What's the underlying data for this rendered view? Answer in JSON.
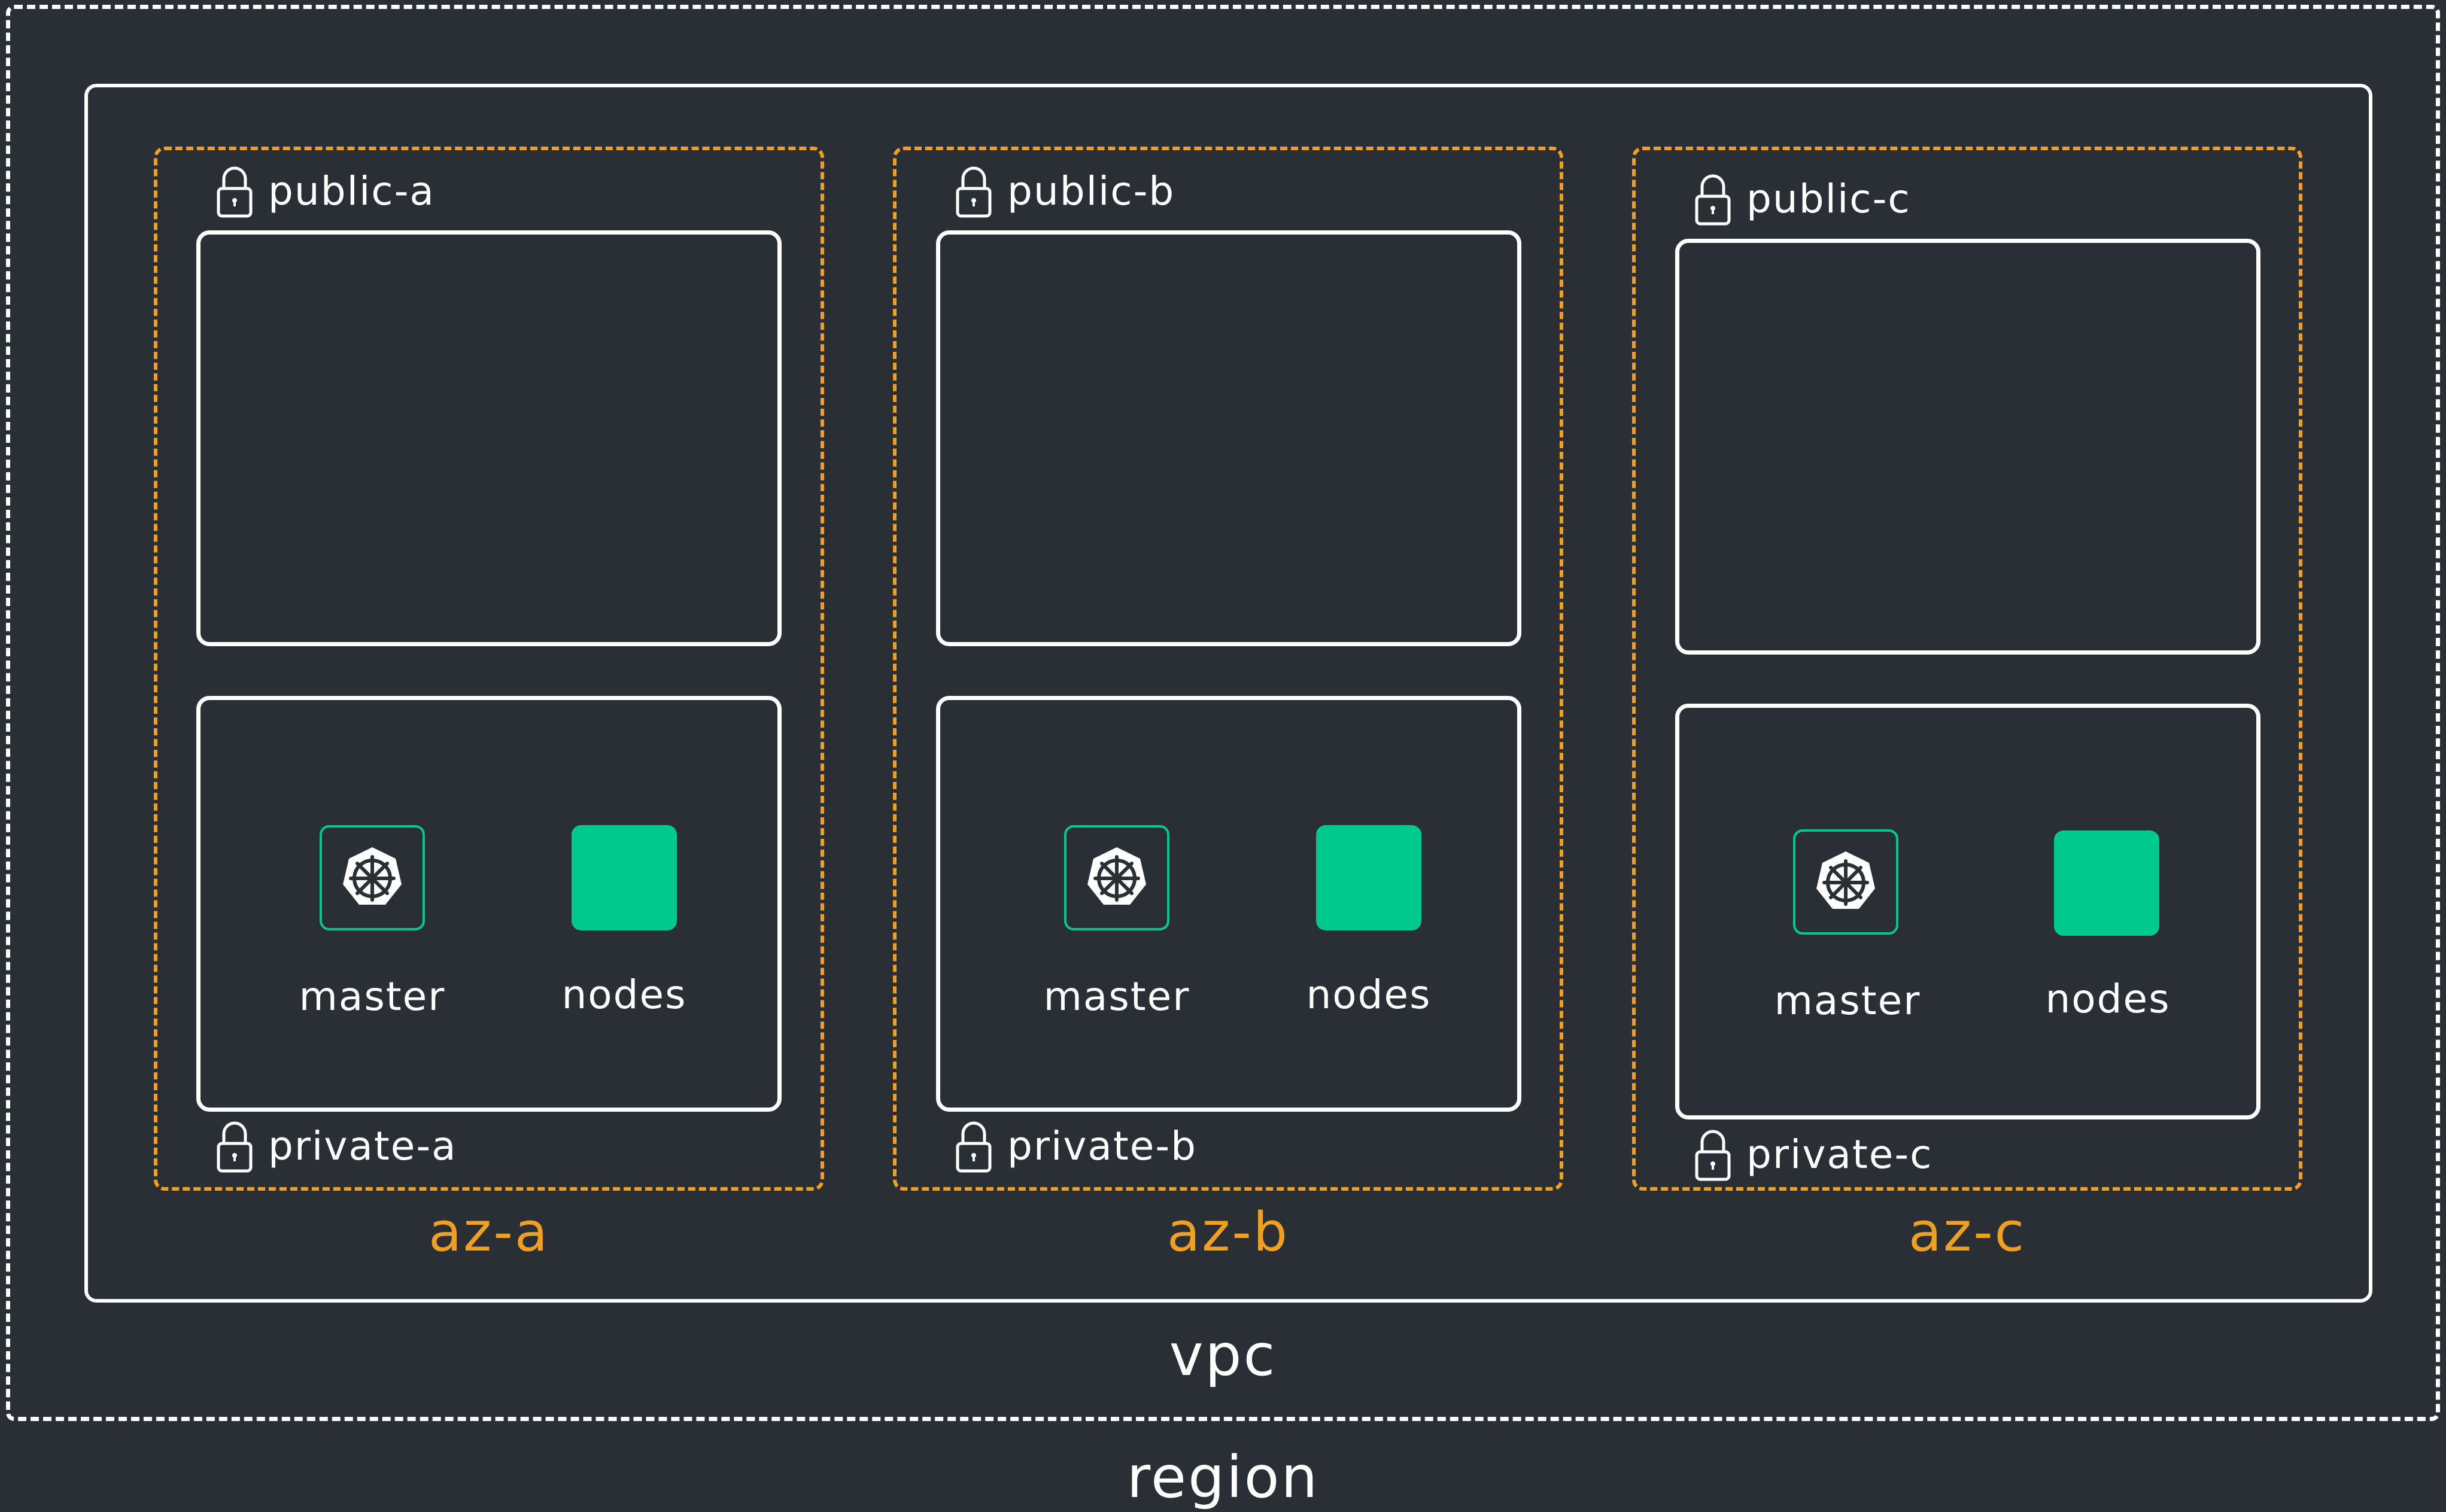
{
  "region_label": "region",
  "vpc_label": "vpc",
  "colors": {
    "background": "#2a2e35",
    "line": "#ffffff",
    "az_border": "#f0a020",
    "accent_green": "#00c98d"
  },
  "zones": [
    {
      "label": "az-a",
      "public_subnet": "public-a",
      "private_subnet": "private-a",
      "master_label": "master",
      "nodes_label": "nodes",
      "master_icon": "kubernetes-helm-icon",
      "lock_icon": "lock-icon"
    },
    {
      "label": "az-b",
      "public_subnet": "public-b",
      "private_subnet": "private-b",
      "master_label": "master",
      "nodes_label": "nodes",
      "master_icon": "kubernetes-helm-icon",
      "lock_icon": "lock-icon"
    },
    {
      "label": "az-c",
      "public_subnet": "public-c",
      "private_subnet": "private-c",
      "master_label": "master",
      "nodes_label": "nodes",
      "master_icon": "kubernetes-helm-icon",
      "lock_icon": "lock-icon"
    }
  ]
}
